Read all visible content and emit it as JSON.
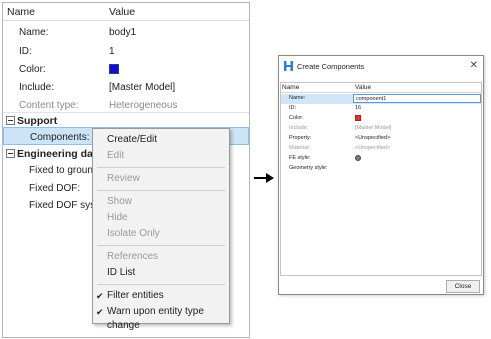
{
  "grid": {
    "col_name": "Name",
    "col_value": "Value",
    "rows": [
      {
        "label": "Name:",
        "value": "body1"
      },
      {
        "label": "ID:",
        "value": "1"
      },
      {
        "label": "Color:",
        "value": ""
      },
      {
        "label": "Include:",
        "value": "[Master Model]"
      },
      {
        "label": "Content type:",
        "value": "Heterogeneous"
      }
    ],
    "color_value": "#1010d0",
    "support_group": "Support",
    "components_label": "Components:",
    "engineering_group": "Engineering data",
    "eng_rows": [
      "Fixed to ground:",
      "Fixed DOF:",
      "Fixed DOF system"
    ]
  },
  "menu": {
    "items": [
      {
        "label": "Create/Edit",
        "disabled": false
      },
      {
        "label": "Edit",
        "disabled": true
      },
      {
        "label": "Review",
        "disabled": true
      },
      {
        "label": "Show",
        "disabled": true
      },
      {
        "label": "Hide",
        "disabled": true
      },
      {
        "label": "Isolate Only",
        "disabled": true
      },
      {
        "label": "References",
        "disabled": true
      },
      {
        "label": "ID List",
        "disabled": false
      },
      {
        "label": "Filter entities",
        "checked": true
      },
      {
        "label": "Warn upon entity type change",
        "checked": true
      }
    ]
  },
  "dialog": {
    "title": "Create Components",
    "close_glyph": "✕",
    "col_name": "Name",
    "col_value": "Value",
    "rows": [
      {
        "label": "Name:",
        "value": "component1"
      },
      {
        "label": "ID:",
        "value": "16"
      },
      {
        "label": "Color:",
        "value": ""
      },
      {
        "label": "Include:",
        "value": "[Master Model]"
      },
      {
        "label": "Property:",
        "value": "<Unspecified>"
      },
      {
        "label": "Material:",
        "value": "<Unspecified>"
      },
      {
        "label": "FE style:",
        "value": ""
      },
      {
        "label": "Geometry style:",
        "value": ""
      }
    ],
    "color_value": "#e8342a",
    "close_button": "Close"
  }
}
